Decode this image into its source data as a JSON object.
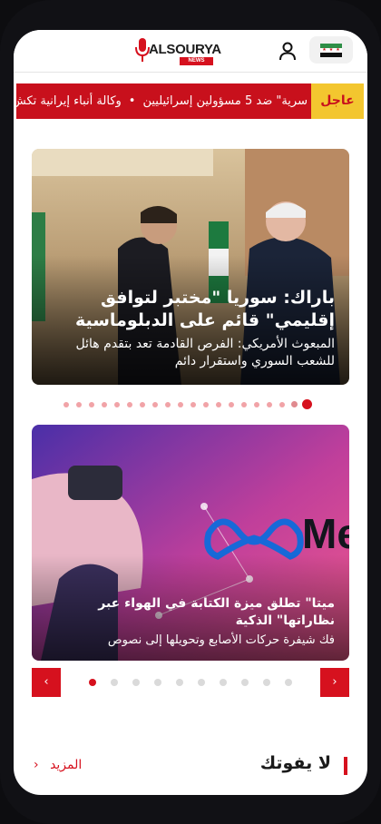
{
  "header": {
    "logo_text": "ALSOURYA",
    "logo_badge": "NEWS"
  },
  "ticker": {
    "label": "عاجل",
    "items": [
      "سرية\" ضد 5 مسؤولين إسرائيليين",
      "وكالة أنباء إيرانية تكش"
    ],
    "separator": "•"
  },
  "slider1": {
    "headline": "باراك: سوريا \"مختبر لتوافق إقليمي\" قائم على الدبلوماسية",
    "subheadline": "المبعوث الأمريكي: الفرص القادمة تعد بتقدم هائل للشعب السوري واستقرار دائم"
  },
  "slider2": {
    "headline": "ميتا\" تطلق ميزة الكتابة في الهواء عبر نظاراتها\" الذكية",
    "subheadline": "فك شيفرة حركات الأصابع وتحويلها إلى نصوص",
    "prev_label": "‹",
    "next_label": "›",
    "image_text": "Me"
  },
  "section": {
    "title": "لا يفوتك",
    "more_label": "المزيد",
    "more_icon": "chevron-left-icon"
  },
  "colors": {
    "brand_red": "#d6111e",
    "ticker_label_bg": "#f3c62f"
  }
}
